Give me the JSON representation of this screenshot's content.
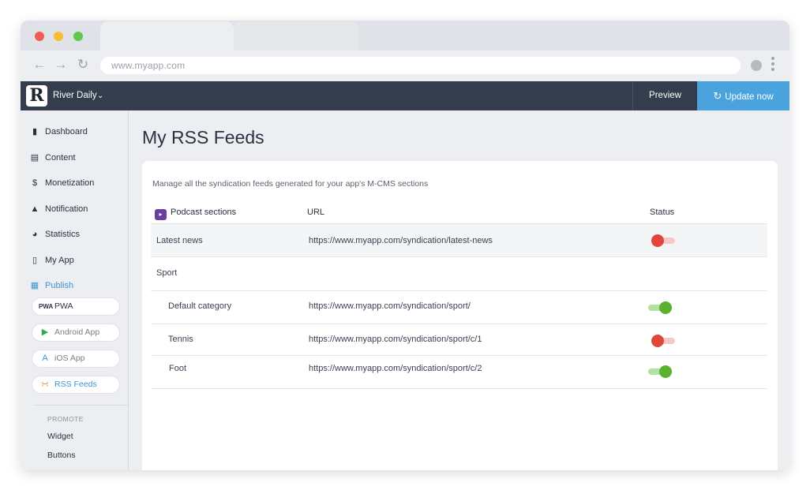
{
  "browser": {
    "address": "www.myapp.com"
  },
  "header": {
    "app_name": "River Daily",
    "logo_letter": "R",
    "preview_label": "Preview",
    "update_label": "Update now"
  },
  "sidebar": {
    "items": [
      {
        "label": "Dashboard",
        "icon": "bar-chart-icon"
      },
      {
        "label": "Content",
        "icon": "document-icon"
      },
      {
        "label": "Monetization",
        "icon": "dollar-icon"
      },
      {
        "label": "Notification",
        "icon": "bell-icon"
      },
      {
        "label": "Statistics",
        "icon": "pie-chart-icon"
      },
      {
        "label": "My App",
        "icon": "phone-icon"
      },
      {
        "label": "Publish",
        "icon": "store-icon"
      }
    ],
    "publish_items": [
      {
        "label": "PWA",
        "icon": "pwa-icon"
      },
      {
        "label": "Android App",
        "icon": "play-store-icon"
      },
      {
        "label": "iOS App",
        "icon": "app-store-icon"
      },
      {
        "label": "RSS Feeds",
        "icon": "rss-icon"
      }
    ],
    "promote_heading": "PROMOTE",
    "promote_items": [
      "Widget",
      "Buttons"
    ]
  },
  "main": {
    "title": "My RSS Feeds",
    "description": "Manage all the syndication feeds generated for your app's M-CMS sections",
    "columns": {
      "section": "Podcast sections",
      "url": "URL",
      "status": "Status"
    },
    "rows": [
      {
        "name": "Latest news",
        "url": "https://www.myapp.com/syndication/latest-news",
        "status": "off"
      },
      {
        "name": "Sport",
        "url": "",
        "status": ""
      },
      {
        "name": "Default category",
        "url": "https://www.myapp.com/syndication/sport/",
        "status": "on"
      },
      {
        "name": "Tennis",
        "url": "https://www.myapp.com/syndication/sport/c/1",
        "status": "off"
      },
      {
        "name": "Foot",
        "url": "https://www.myapp.com/syndication/sport/c/2",
        "status": "on"
      }
    ]
  },
  "colors": {
    "header_bg": "#333d4e",
    "accent": "#4aa3dc",
    "toggle_on": "#5ab22c",
    "toggle_off": "#e0463b"
  }
}
